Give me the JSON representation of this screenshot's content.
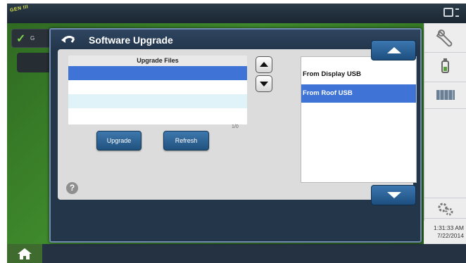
{
  "background": {
    "brand_text": "GEN III",
    "status_text": "G",
    "clock": {
      "time": "1:31:33 AM",
      "date": "7/22/2014"
    }
  },
  "dialog": {
    "title": "Software Upgrade",
    "files_table": {
      "header": "Upgrade Files",
      "rows": [
        "",
        "",
        "",
        ""
      ],
      "page_indicator": "1/0"
    },
    "buttons": {
      "upgrade": "Upgrade",
      "refresh": "Refresh"
    },
    "help": "?",
    "sources": [
      "From Display USB",
      "From Roof USB"
    ],
    "selected_source": "From Roof USB"
  },
  "icons": [
    "back-arrow-icon",
    "scroll-up-arrow-icon",
    "scroll-down-arrow-icon",
    "help-icon",
    "wrench-icon",
    "gauge-icon",
    "field-map-icon",
    "gears-icon",
    "home-icon",
    "display-icon",
    "check-icon"
  ],
  "colors": {
    "accent_blue": "#3f74d6",
    "button_blue": "#2f6699",
    "dialog_navy": "#24364a",
    "field_green": "#3f8a2c"
  }
}
